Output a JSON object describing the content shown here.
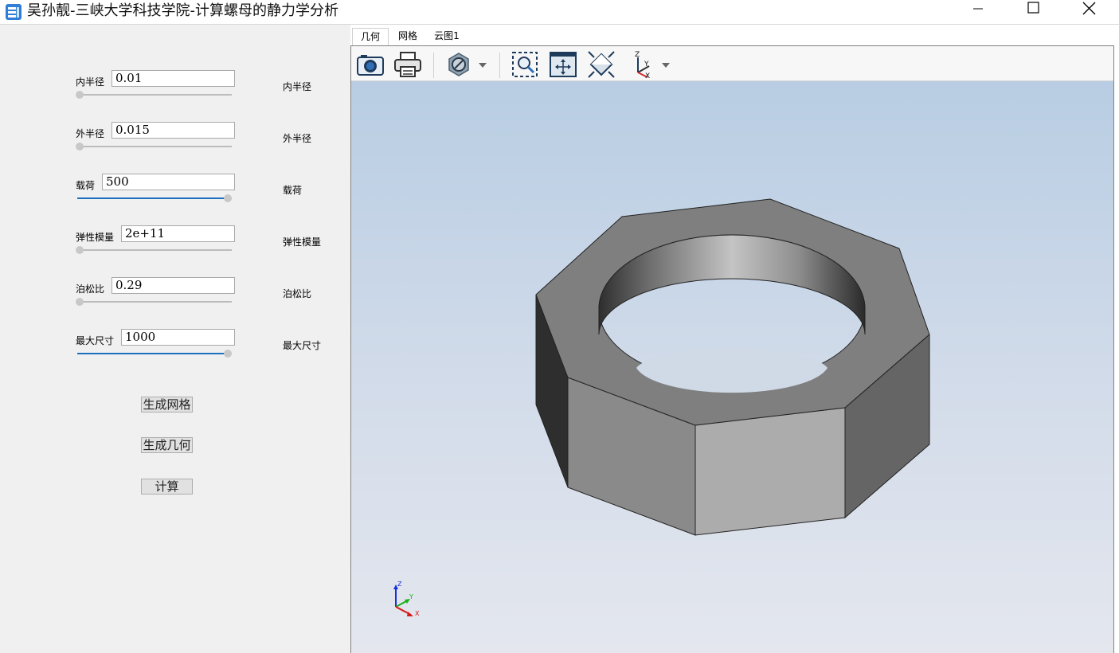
{
  "window": {
    "title": "吴孙靓-三峡大学科技学院-计算螺母的静力学分析"
  },
  "params": [
    {
      "label": "内半径",
      "value": "0.01",
      "right_label": "内半径",
      "slider_fraction": 0.0
    },
    {
      "label": "外半径",
      "value": "0.015",
      "right_label": "外半径",
      "slider_fraction": 0.0
    },
    {
      "label": "载荷",
      "value": "500",
      "right_label": "载荷",
      "slider_fraction": 1.0
    },
    {
      "label": "弹性模量",
      "value": "2e+11",
      "right_label": "弹性模量",
      "slider_fraction": 0.0
    },
    {
      "label": "泊松比",
      "value": "0.29",
      "right_label": "泊松比",
      "slider_fraction": 0.0
    },
    {
      "label": "最大尺寸",
      "value": "1000",
      "right_label": "最大尺寸",
      "slider_fraction": 1.0
    }
  ],
  "buttons": {
    "mesh": "生成网格",
    "geometry": "生成几何",
    "compute": "计算"
  },
  "tabs": [
    "几何",
    "网格",
    "云图1"
  ],
  "triad": {
    "x": "X",
    "y": "Y",
    "z": "Z"
  },
  "colors": {
    "accent": "#1a6fc0",
    "viewport_top": "#b8cde3",
    "viewport_bottom": "#e4e7ee"
  }
}
